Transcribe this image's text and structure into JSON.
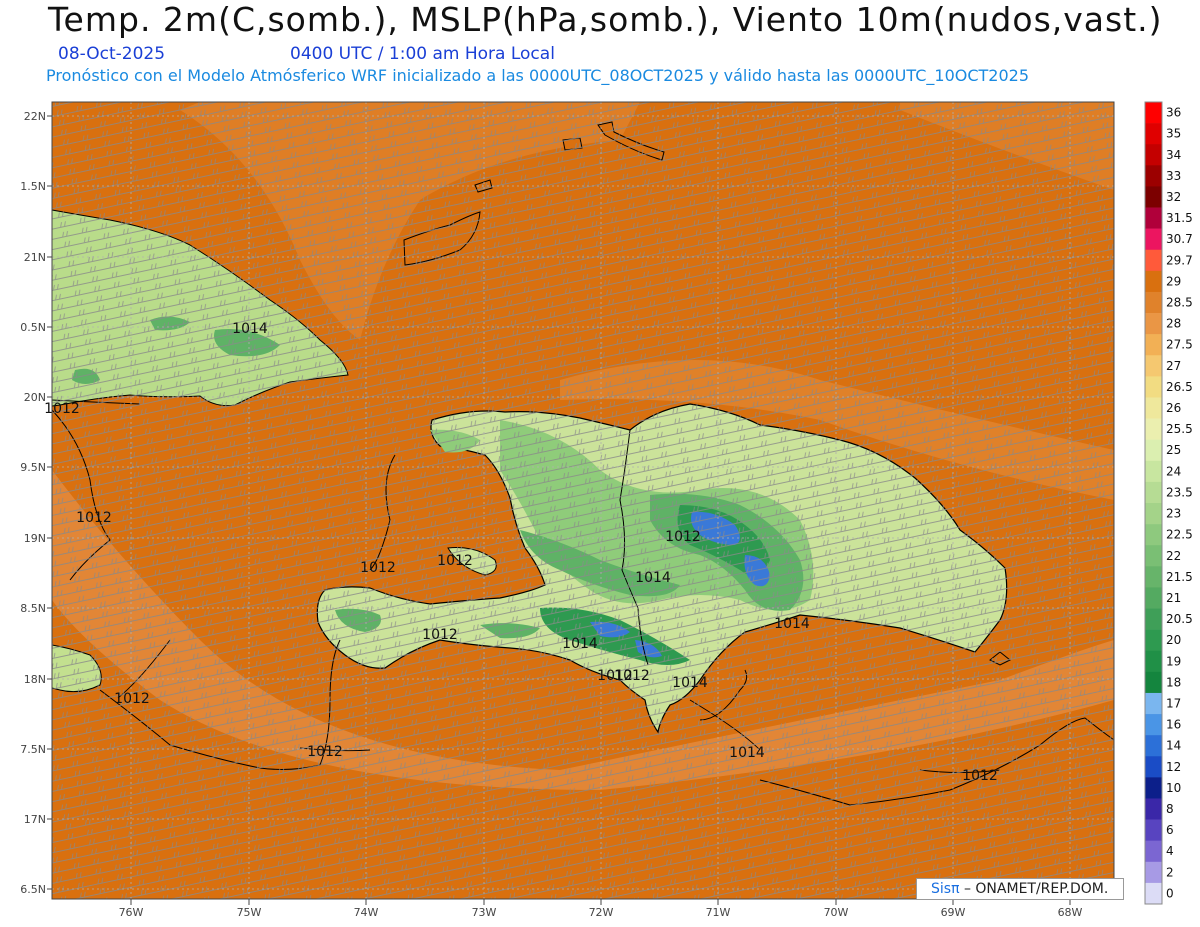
{
  "header": {
    "title": "Temp. 2m(C,somb.), MSLP(hPa,somb.), Viento 10m(nudos,vast.)",
    "date": "08-Oct-2025",
    "time": "0400 UTC / 1:00 am Hora Local",
    "model_info": "Pronóstico con el Modelo Atmósferico WRF inicializado a las 0000UTC_08OCT2025 y válido hasta las  0000UTC_10OCT2025"
  },
  "map": {
    "lat_labels": [
      "22N",
      "1.5N",
      "21N",
      "0.5N",
      "20N",
      "9.5N",
      "19N",
      "8.5N",
      "18N",
      "7.5N",
      "17N",
      "6.5N"
    ],
    "lon_labels": [
      "76W",
      "75W",
      "74W",
      "73W",
      "72W",
      "71W",
      "70W",
      "69W",
      "68W"
    ],
    "isobar_labels": [
      "1014",
      "1012",
      "1012",
      "1012",
      "1012",
      "1012",
      "1012",
      "1012",
      "1012",
      "1014",
      "1014",
      "1014",
      "1012",
      "1014",
      "1014",
      "1012",
      "1012"
    ],
    "colors": {
      "ocean": "#d9700f",
      "ocean_light": "#e48a3b",
      "land_low": "#d9e49a",
      "land_mid": "#8fcc7a",
      "land_high": "#2e9a50",
      "peak": "#3a79d8",
      "contour": "#000000",
      "barb": "#8a8a8a"
    }
  },
  "colorbar": {
    "labels": [
      "36",
      "35",
      "34",
      "33",
      "32",
      "31.5",
      "30.7",
      "29.7",
      "29",
      "28.5",
      "28",
      "27.5",
      "27",
      "26.5",
      "26",
      "25.5",
      "25",
      "24",
      "23.5",
      "23",
      "22.5",
      "22",
      "21.5",
      "21",
      "20.5",
      "20",
      "19",
      "18",
      "17",
      "16",
      "14",
      "12",
      "10",
      "8",
      "6",
      "4",
      "2",
      "0"
    ],
    "colors": [
      "#ff0000",
      "#e00000",
      "#c40000",
      "#9c0000",
      "#7c0000",
      "#b0003a",
      "#ec1560",
      "#ff5a3a",
      "#d9700f",
      "#e0822b",
      "#ea9645",
      "#f2b055",
      "#f5c870",
      "#f2dc82",
      "#efe89c",
      "#ebefaf",
      "#dbefb0",
      "#c8e6a0",
      "#b6dc94",
      "#a4d389",
      "#8ec97e",
      "#7abf74",
      "#67b46a",
      "#54aa61",
      "#3f9f58",
      "#2e9a50",
      "#209047",
      "#14853e",
      "#7ab6ef",
      "#4a95e6",
      "#2c70d8",
      "#1a4cc6",
      "#0c1f8a",
      "#3a27a8",
      "#5844c0",
      "#7b66d2",
      "#a79ae5",
      "#dcdcf6"
    ]
  },
  "footer": {
    "brand_prefix": "Sis",
    "brand_pi": "π",
    "brand_suffix": " – ONAMET/REP.DOM."
  }
}
